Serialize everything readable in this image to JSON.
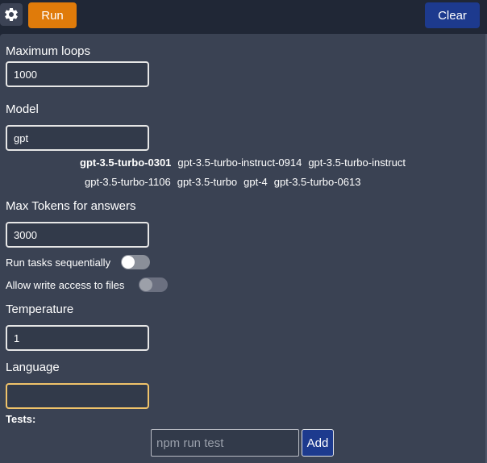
{
  "toolbar": {
    "settings_icon": "gear-icon",
    "run_label": "Run",
    "clear_label": "Clear"
  },
  "colors": {
    "run": "#e07b0a",
    "clear": "#1d3a8e",
    "panel": "#3a4253",
    "focus": "#f0c36a"
  },
  "form": {
    "max_loops": {
      "label": "Maximum loops",
      "value": "1000"
    },
    "model": {
      "label": "Model",
      "value": "gpt",
      "suggestions_row1": [
        "gpt-3.5-turbo-0301",
        "gpt-3.5-turbo-instruct-0914",
        "gpt-3.5-turbo-instruct"
      ],
      "suggestions_row2": [
        "gpt-3.5-turbo-1106",
        "gpt-3.5-turbo",
        "gpt-4",
        "gpt-3.5-turbo-0613"
      ]
    },
    "max_tokens": {
      "label": "Max Tokens for answers",
      "value": "3000"
    },
    "run_sequential": {
      "label": "Run tasks sequentially",
      "on": false
    },
    "write_access": {
      "label": "Allow write access to files",
      "on": false,
      "disabled": true
    },
    "temperature": {
      "label": "Temperature",
      "value": "1"
    },
    "language": {
      "label": "Language",
      "value": ""
    },
    "tests": {
      "label": "Tests:",
      "placeholder": "npm run test",
      "add_label": "Add"
    }
  }
}
